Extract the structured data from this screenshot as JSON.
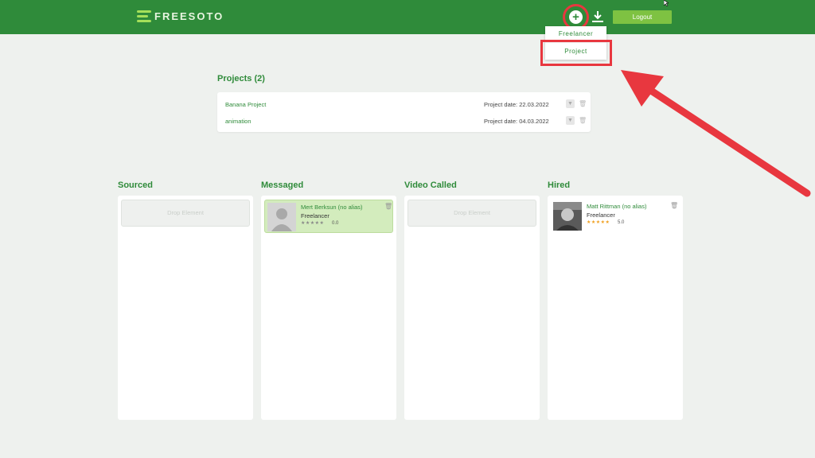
{
  "header": {
    "logo_text": "FREESOTO",
    "logout_label": "Logout",
    "add_icon": "plus-circle-icon",
    "download_icon": "download-icon",
    "brand_color": "#2f8b3a",
    "accent_color": "#7ec242"
  },
  "add_menu": {
    "items": [
      {
        "label": "Freelancer"
      },
      {
        "label": "Project"
      }
    ]
  },
  "projects": {
    "title": "Projects (2)",
    "rows": [
      {
        "name": "Banana Project",
        "date": "Project date: 22.03.2022"
      },
      {
        "name": "animation",
        "date": "Project date: 04.03.2022"
      }
    ]
  },
  "pipeline": {
    "columns": [
      {
        "title": "Sourced",
        "drop_label": "Drop Element"
      },
      {
        "title": "Messaged",
        "card": {
          "name": "Mert Berksun (no alias)",
          "role": "Freelancer",
          "rating": "0.0",
          "stars": 5,
          "highlight": true
        }
      },
      {
        "title": "Video Called",
        "drop_label": "Drop Element"
      },
      {
        "title": "Hired",
        "card": {
          "name": "Matt Rittman (no alias)",
          "role": "Freelancer",
          "rating": "5.0",
          "stars": 5,
          "highlight": false
        }
      }
    ]
  },
  "annotation_color": "#e8373f"
}
